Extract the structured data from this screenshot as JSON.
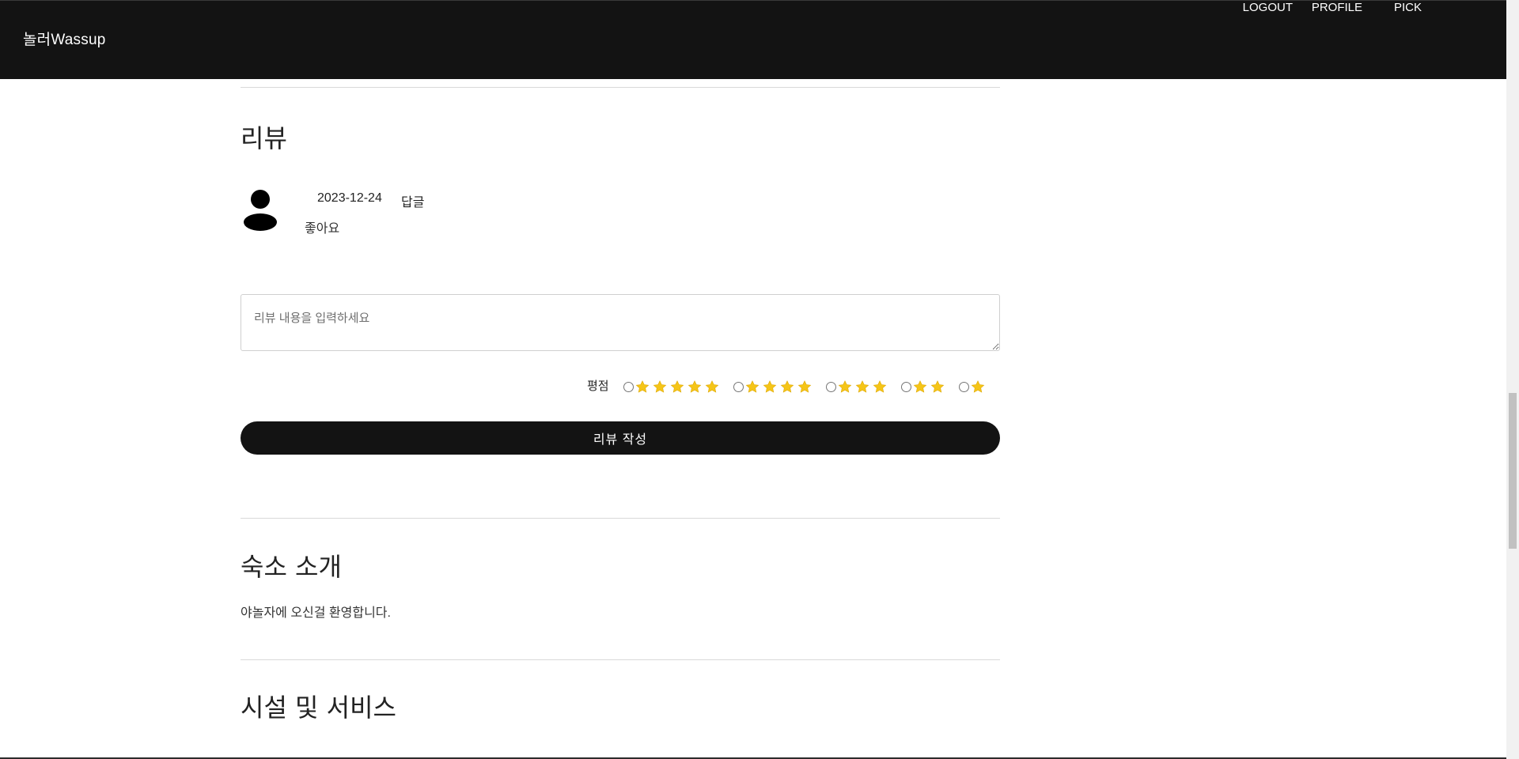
{
  "navbar": {
    "brand": "놀러Wassup",
    "links": [
      "LOGOUT",
      "PROFILE",
      "PICK"
    ]
  },
  "review_section": {
    "title": "리뷰",
    "reviews": [
      {
        "date": "2023-12-24",
        "reply_label": "답글",
        "content": "좋아요"
      }
    ],
    "form": {
      "placeholder": "리뷰 내용을 입력하세요",
      "rating_label": "평점",
      "rating_options": [
        5,
        4,
        3,
        2,
        1
      ],
      "submit_label": "리뷰 작성"
    }
  },
  "intro_section": {
    "title": "숙소 소개",
    "text": "야놀자에 오신걸 환영합니다."
  },
  "facilities_section": {
    "title": "시설 및 서비스"
  },
  "colors": {
    "navbar_bg": "#131313",
    "star": "#F5C518",
    "button_bg": "#131313"
  },
  "icons": [
    "avatar-icon",
    "star-icon"
  ]
}
